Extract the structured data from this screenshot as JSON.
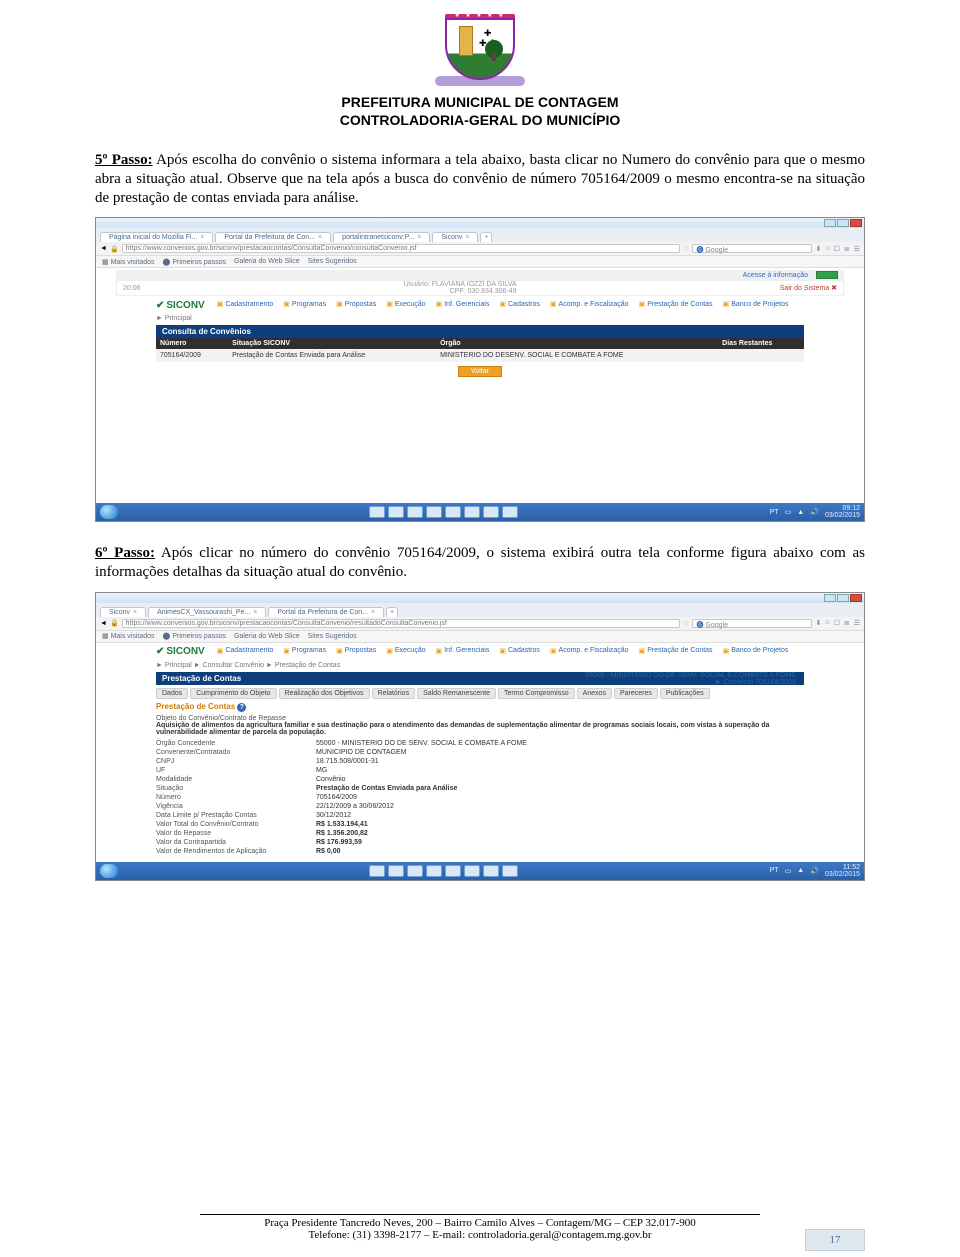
{
  "header": {
    "line1": "PREFEITURA MUNICIPAL DE CONTAGEM",
    "line2": "CONTROLADORIA-GERAL DO MUNICÍPIO"
  },
  "watermark_text": "",
  "para1": {
    "lead_label": "5º Passo:",
    "lead_rest": " Após escolha do convênio o sistema informara a tela abaixo, basta clicar no Numero do convênio para que o mesmo abra a situação atual. Observe que na tela após a busca do convênio de número 705164/2009 o mesmo encontra-se na situação de prestação de contas enviada para análise."
  },
  "para2": {
    "lead_label": "6º Passo:",
    "lead_rest": " Após clicar no número do convênio 705164/2009, o sistema exibirá outra tela conforme figura abaixo com as informações detalhas da situação atual do convênio."
  },
  "shot1": {
    "tabs": [
      "Página inicial do Mozilla Fi...",
      "Portal da Prefeitura de Con...",
      "portalintranetsiconv:P...",
      "Siconv"
    ],
    "addr_prefix": "https://www.convenios.gov.br/siconv/prestacaocontas/ConsultaConvenio/consultaConvenio.jsf",
    "search_ph": "Google",
    "bookmarks_label_1": "Mais visitados",
    "bookmarks_label_2": "Primeiros passos",
    "bookmarks_label_3": "Galeria do Web Slice",
    "bookmarks_label_4": "Sites Sugeridos",
    "brasil_access": "Acesse à informação",
    "userbar_time": "20:06",
    "userbar_name": "Usuário: FLAVIANA IOZZI DA SILVA",
    "userbar_cpf": "CPF: 030.934.306-49",
    "userbar_sair": "Sair do Sistema",
    "logo": "SICONV",
    "menu": [
      "Cadastramento",
      "Programas",
      "Propostas",
      "Execução",
      "Inf. Gerenciais",
      "Cadastros",
      "Acomp. e Fiscalização",
      "Prestação de Contas",
      "Banco de Projetos"
    ],
    "crumb": "► Principal",
    "panel_title": "Consulta de Convênios",
    "th1": "Número",
    "th2": "Situação SICONV",
    "th3": "Órgão",
    "th4": "Dias Restantes",
    "row_num": "705164/2009",
    "row_sit": "Prestação de Contas Enviada para Análise",
    "row_org": "MINISTERIO DO DESENV. SOCIAL E COMBATE A FOME",
    "btn": "Voltar",
    "tray_lang": "PT",
    "tray_time": "09:12",
    "tray_date": "03/02/2015"
  },
  "shot2": {
    "tabs": [
      "Siconv",
      "AnimesCX_Vassourashi_Pe...",
      "Portal da Prefeitura de Con..."
    ],
    "addr_prefix": "https://www.convenios.gov.br/siconv/prestacaocontas/ConsultaConvenio/resultadoConsultaConvenio.jsf",
    "search_ph": "Google",
    "logo": "SICONV",
    "menu": [
      "Cadastramento",
      "Programas",
      "Propostas",
      "Execução",
      "Inf. Gerenciais",
      "Cadastros",
      "Acomp. e Fiscalização",
      "Prestação de Contas",
      "Banco de Projetos"
    ],
    "crumb": "► Principal ► Consultar Convênio ► Prestação de Contas",
    "panel_title": "Prestação de Contas",
    "aside1": "55000 - MINISTERIO DO DE SENV. SOCIAL E COMBATE A FOME",
    "aside2": "► Convênio 705164/2009",
    "subtabs": [
      "Dados",
      "Cumprimento do Objeto",
      "Realização dos Objetivos",
      "Relatórios",
      "Saldo Remanescente",
      "Termo Compromisso",
      "Anexos",
      "Pareceres",
      "Publicações"
    ],
    "section_title": "Prestação de Contas",
    "obj_label": "Objeto do Convênio/Contrato de Repasse",
    "obj_text": "Aquisição de alimentos da agricultura familiar e sua destinação para o atendimento das demandas de suplementação alimentar de programas sociais locais, com vistas à superação da vulnerabilidade alimentar de parcela da população.",
    "rows": [
      {
        "k": "Órgão Concedente",
        "v": "55000 - MINISTERIO DO DE SENV. SOCIAL E COMBATE A FOME"
      },
      {
        "k": "Convenente/Contratado",
        "v": "MUNICIPIO DE CONTAGEM"
      },
      {
        "k": "CNPJ",
        "v": "18.715.508/0001-31"
      },
      {
        "k": "UF",
        "v": "MG"
      },
      {
        "k": "Modalidade",
        "v": "Convênio"
      },
      {
        "k": "Situação",
        "v": "Prestação de Contas Enviada para Análise",
        "bold": true
      },
      {
        "k": "Número",
        "v": "705164/2009"
      },
      {
        "k": "Vigência",
        "v": "22/12/2009 a 30/06/2012"
      },
      {
        "k": "Data Limite p/ Prestação Contas",
        "v": "30/12/2012"
      },
      {
        "k": "Valor Total do Convênio/Contrato",
        "v": "R$ 1.533.194,41",
        "bold": true
      },
      {
        "k": "Valor do Repasse",
        "v": "R$ 1.356.200,82",
        "bold": true
      },
      {
        "k": "Valor da Contrapartida",
        "v": "R$ 176.993,59",
        "bold": true
      },
      {
        "k": "Valor de Rendimentos de Aplicação",
        "v": "R$ 0,00",
        "bold": true
      }
    ],
    "tray_lang": "PT",
    "tray_time": "11:52",
    "tray_date": "03/02/2015"
  },
  "footer": {
    "l1": "Praça Presidente Tancredo Neves, 200 – Bairro Camilo Alves – Contagem/MG – CEP 32.017-900",
    "l2": "Telefone: (31) 3398-2177 – E-mail: controladoria.geral@contagem.mg.gov.br"
  },
  "page_number": "17"
}
